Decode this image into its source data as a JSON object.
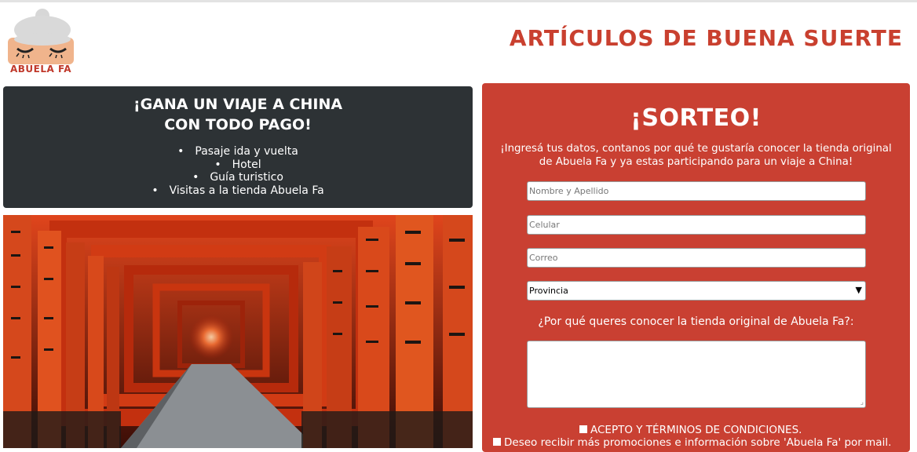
{
  "brand": {
    "name": "ABUELA FA"
  },
  "site_title": "ARTÍCULOS DE BUENA SUERTE",
  "promo": {
    "heading_line1": "¡GANA UN VIAJE A CHINA",
    "heading_line2": "CON TODO PAGO!",
    "items": [
      "Pasaje ida y vuelta",
      "Hotel",
      "Guía turistico",
      "Visitas a la tienda Abuela Fa"
    ]
  },
  "form": {
    "title": "¡SORTEO!",
    "intro": "¡Ingresá tus datos, contanos por qué te gustaría conocer la tienda original de Abuela Fa y ya estas participando para un viaje a China!",
    "name_placeholder": "Nombre y Apellido",
    "phone_placeholder": "Celular",
    "email_placeholder": "Correo",
    "province_selected": "Provincia",
    "question": "¿Por qué queres conocer la tienda original de Abuela Fa?:",
    "terms_label": "ACEPTO Y TÉRMINOS DE CONDICIONES.",
    "newsletter_label": "Deseo recibir más promociones e información sobre 'Abuela Fa' por mail."
  },
  "colors": {
    "accent": "#c94032",
    "dark_panel": "#2d3235",
    "title_red": "#c9402f"
  },
  "icons": {
    "logo": "grandma-face-logo",
    "dropdown": "chevron-down-icon",
    "resize": "resize-grip-icon"
  }
}
